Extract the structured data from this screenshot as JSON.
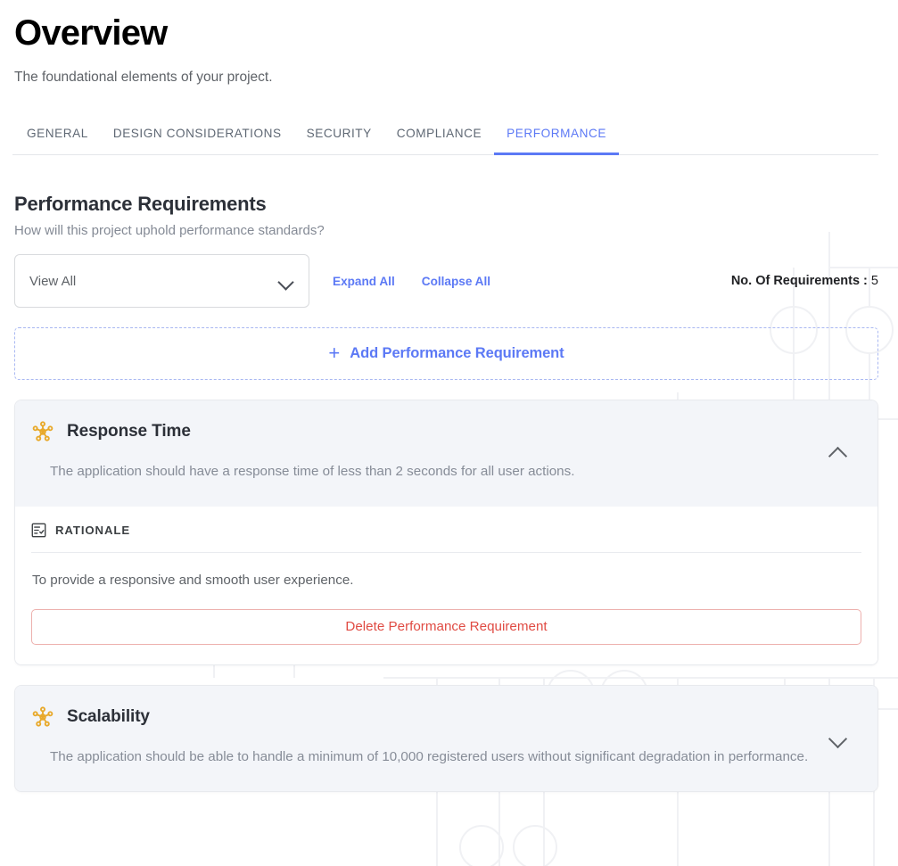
{
  "header": {
    "title": "Overview",
    "subtitle": "The foundational elements of your project."
  },
  "tabs": [
    {
      "label": "GENERAL",
      "active": false
    },
    {
      "label": "DESIGN CONSIDERATIONS",
      "active": false
    },
    {
      "label": "SECURITY",
      "active": false
    },
    {
      "label": "COMPLIANCE",
      "active": false
    },
    {
      "label": "PERFORMANCE",
      "active": true
    }
  ],
  "section": {
    "title": "Performance Requirements",
    "subtitle": "How will this project uphold performance standards?"
  },
  "controls": {
    "select": {
      "value": "View All",
      "icon": "chevron-down-icon",
      "options": [
        "View All"
      ]
    },
    "expand_all_label": "Expand All",
    "collapse_all_label": "Collapse All",
    "count_label": "No. Of Requirements :",
    "count_value": "5"
  },
  "add_button": {
    "icon": "plus-icon",
    "label": "Add Performance Requirement"
  },
  "requirements": [
    {
      "icon": "hub-network-icon",
      "title": "Response Time",
      "description": "The application should have a response time of less than 2 seconds for all user actions.",
      "expanded": true,
      "toggle_icon": "chevron-up-icon",
      "rationale_icon": "checklist-icon",
      "rationale_label": "RATIONALE",
      "rationale_text": "To provide a responsive and smooth user experience.",
      "delete_label": "Delete Performance Requirement"
    },
    {
      "icon": "hub-network-icon",
      "title": "Scalability",
      "description": "The application should be able to handle a minimum of 10,000 registered users without significant degradation in performance.",
      "expanded": false,
      "toggle_icon": "chevron-down-icon"
    }
  ],
  "colors": {
    "accent_blue": "#5c79f5",
    "icon_amber": "#e8a92b",
    "danger_red": "#e04b43",
    "card_header_gray": "#f3f5f9",
    "muted_text": "#868c97"
  }
}
